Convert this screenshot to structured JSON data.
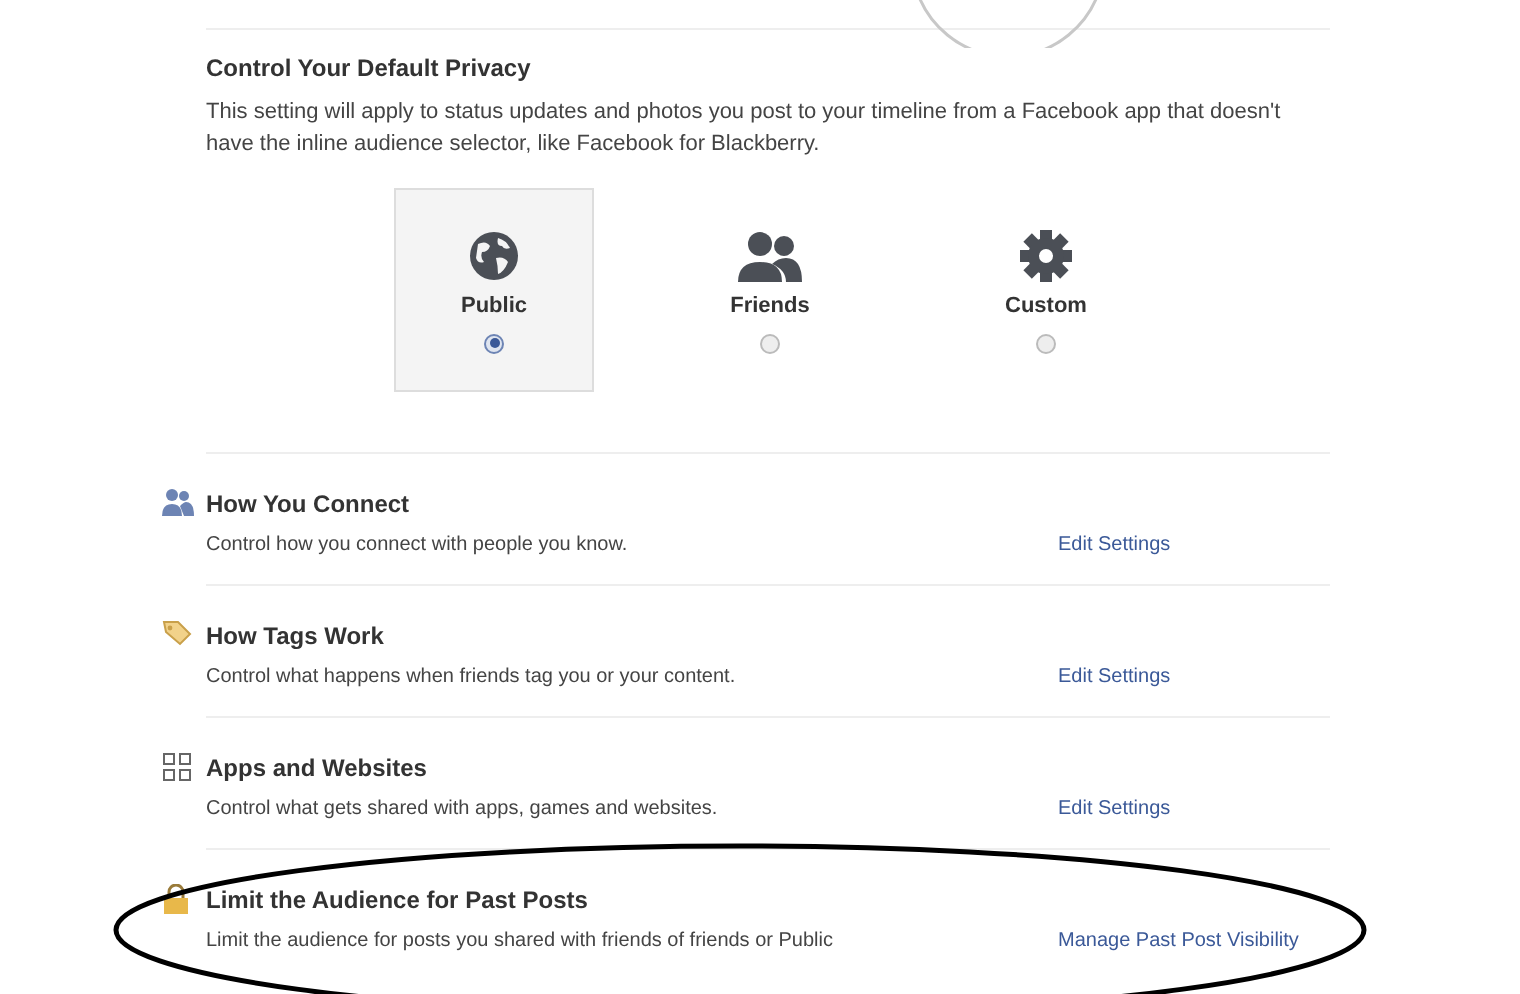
{
  "privacy": {
    "title": "Control Your Default Privacy",
    "description": "This setting will apply to status updates and photos you post to your timeline from a Facebook app that doesn't have the inline audience selector, like Facebook for Blackberry.",
    "options": [
      {
        "label": "Public",
        "kind": "globe",
        "selected": true
      },
      {
        "label": "Friends",
        "kind": "friends",
        "selected": false
      },
      {
        "label": "Custom",
        "kind": "gear",
        "selected": false
      }
    ]
  },
  "sections": [
    {
      "kind": "people",
      "title": "How You Connect",
      "description": "Control how you connect with people you know.",
      "link": "Edit Settings"
    },
    {
      "kind": "tag",
      "title": "How Tags Work",
      "description": "Control what happens when friends tag you or your content.",
      "link": "Edit Settings"
    },
    {
      "kind": "apps",
      "title": "Apps and Websites",
      "description": "Control what gets shared with apps, games and websites.",
      "link": "Edit Settings"
    },
    {
      "kind": "lock",
      "title": "Limit the Audience for Past Posts",
      "description": "Limit the audience for posts you shared with friends of friends or Public",
      "link": "Manage Past Post Visibility"
    }
  ]
}
